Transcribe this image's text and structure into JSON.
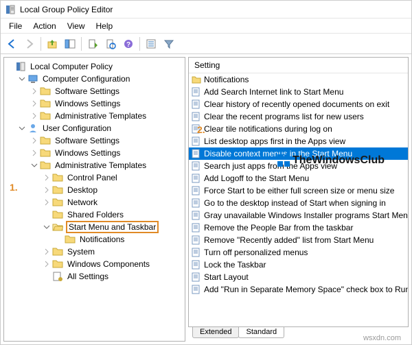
{
  "window": {
    "title": "Local Group Policy Editor"
  },
  "menubar": [
    "File",
    "Action",
    "View",
    "Help"
  ],
  "tree": {
    "root": "Local Computer Policy",
    "computer": {
      "label": "Computer Configuration",
      "children": [
        "Software Settings",
        "Windows Settings",
        "Administrative Templates"
      ]
    },
    "user": {
      "label": "User Configuration",
      "software": "Software Settings",
      "windows": "Windows Settings",
      "admin": {
        "label": "Administrative Templates",
        "control_panel": "Control Panel",
        "desktop": "Desktop",
        "network": "Network",
        "shared_folders": "Shared Folders",
        "start_menu": {
          "label": "Start Menu and Taskbar",
          "notifications": "Notifications"
        },
        "system": "System",
        "windows_components": "Windows Components",
        "all_settings": "All Settings"
      }
    }
  },
  "list": {
    "header": "Setting",
    "items": [
      {
        "kind": "folder",
        "text": "Notifications"
      },
      {
        "kind": "setting",
        "text": "Add Search Internet link to Start Menu"
      },
      {
        "kind": "setting",
        "text": "Clear history of recently opened documents on exit"
      },
      {
        "kind": "setting",
        "text": "Clear the recent programs list for new users"
      },
      {
        "kind": "setting",
        "text": "Clear tile notifications during log on"
      },
      {
        "kind": "setting",
        "text": "List desktop apps first in the Apps view"
      },
      {
        "kind": "setting",
        "text": "Disable context menus in the Start Menu",
        "selected": true
      },
      {
        "kind": "setting",
        "text": "Search just apps from the Apps view"
      },
      {
        "kind": "setting",
        "text": "Add Logoff to the Start Menu"
      },
      {
        "kind": "setting",
        "text": "Force Start to be either full screen size or menu size"
      },
      {
        "kind": "setting",
        "text": "Go to the desktop instead of Start when signing in"
      },
      {
        "kind": "setting",
        "text": "Gray unavailable Windows Installer programs Start Menu"
      },
      {
        "kind": "setting",
        "text": "Remove the People Bar from the taskbar"
      },
      {
        "kind": "setting",
        "text": "Remove \"Recently added\" list from Start Menu"
      },
      {
        "kind": "setting",
        "text": "Turn off personalized menus"
      },
      {
        "kind": "setting",
        "text": "Lock the Taskbar"
      },
      {
        "kind": "setting",
        "text": "Start Layout"
      },
      {
        "kind": "setting",
        "text": "Add \"Run in Separate Memory Space\" check box to Run"
      }
    ]
  },
  "tabs": {
    "extended": "Extended",
    "standard": "Standard"
  },
  "annotations": {
    "one": "1.",
    "two": "2."
  },
  "watermark": {
    "text": "TheWindowsClub",
    "footer": "wsxdn.com"
  },
  "colors": {
    "selection": "#0078d7",
    "highlight": "#e08a26"
  }
}
